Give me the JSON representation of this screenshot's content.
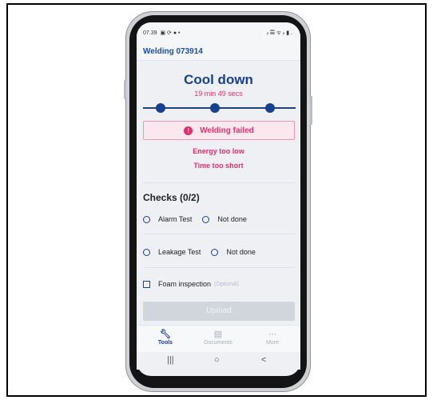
{
  "status_bar": {
    "time": "07.39",
    "left_icons": "▣ ⟳ ● •",
    "right_icons": "ᵢₗ 𝄚 ᯤ ᵢₗ ▮ ."
  },
  "app": {
    "title": "Welding 073914"
  },
  "cooldown": {
    "title": "Cool down",
    "timer": "19 min 49 secs",
    "steps": 3,
    "completed_steps": 3
  },
  "alert": {
    "icon": "exclamation-icon",
    "text": "Welding failed"
  },
  "errors": [
    "Energy too low",
    "Time too short"
  ],
  "checks": {
    "title": "Checks (0/2)",
    "items": [
      {
        "label": "Alarm Test",
        "status": "Not done"
      },
      {
        "label": "Leakage Test",
        "status": "Not done"
      }
    ],
    "optional_item": {
      "label": "Foam inspection",
      "tag": "(Optional)"
    }
  },
  "upload": {
    "label": "Upload"
  },
  "tabs": [
    {
      "label": "Tools",
      "icon": "wrench-icon",
      "active": true
    },
    {
      "label": "Documents",
      "icon": "document-icon",
      "active": false
    },
    {
      "label": "More",
      "icon": "more-icon",
      "active": false
    }
  ],
  "android_nav": {
    "recent": "|||",
    "home": "○",
    "back": "<"
  },
  "colors": {
    "primary": "#17408f",
    "error": "#e0306b",
    "error_bg": "#fbe7ee",
    "disabled": "#d1d5dc"
  }
}
